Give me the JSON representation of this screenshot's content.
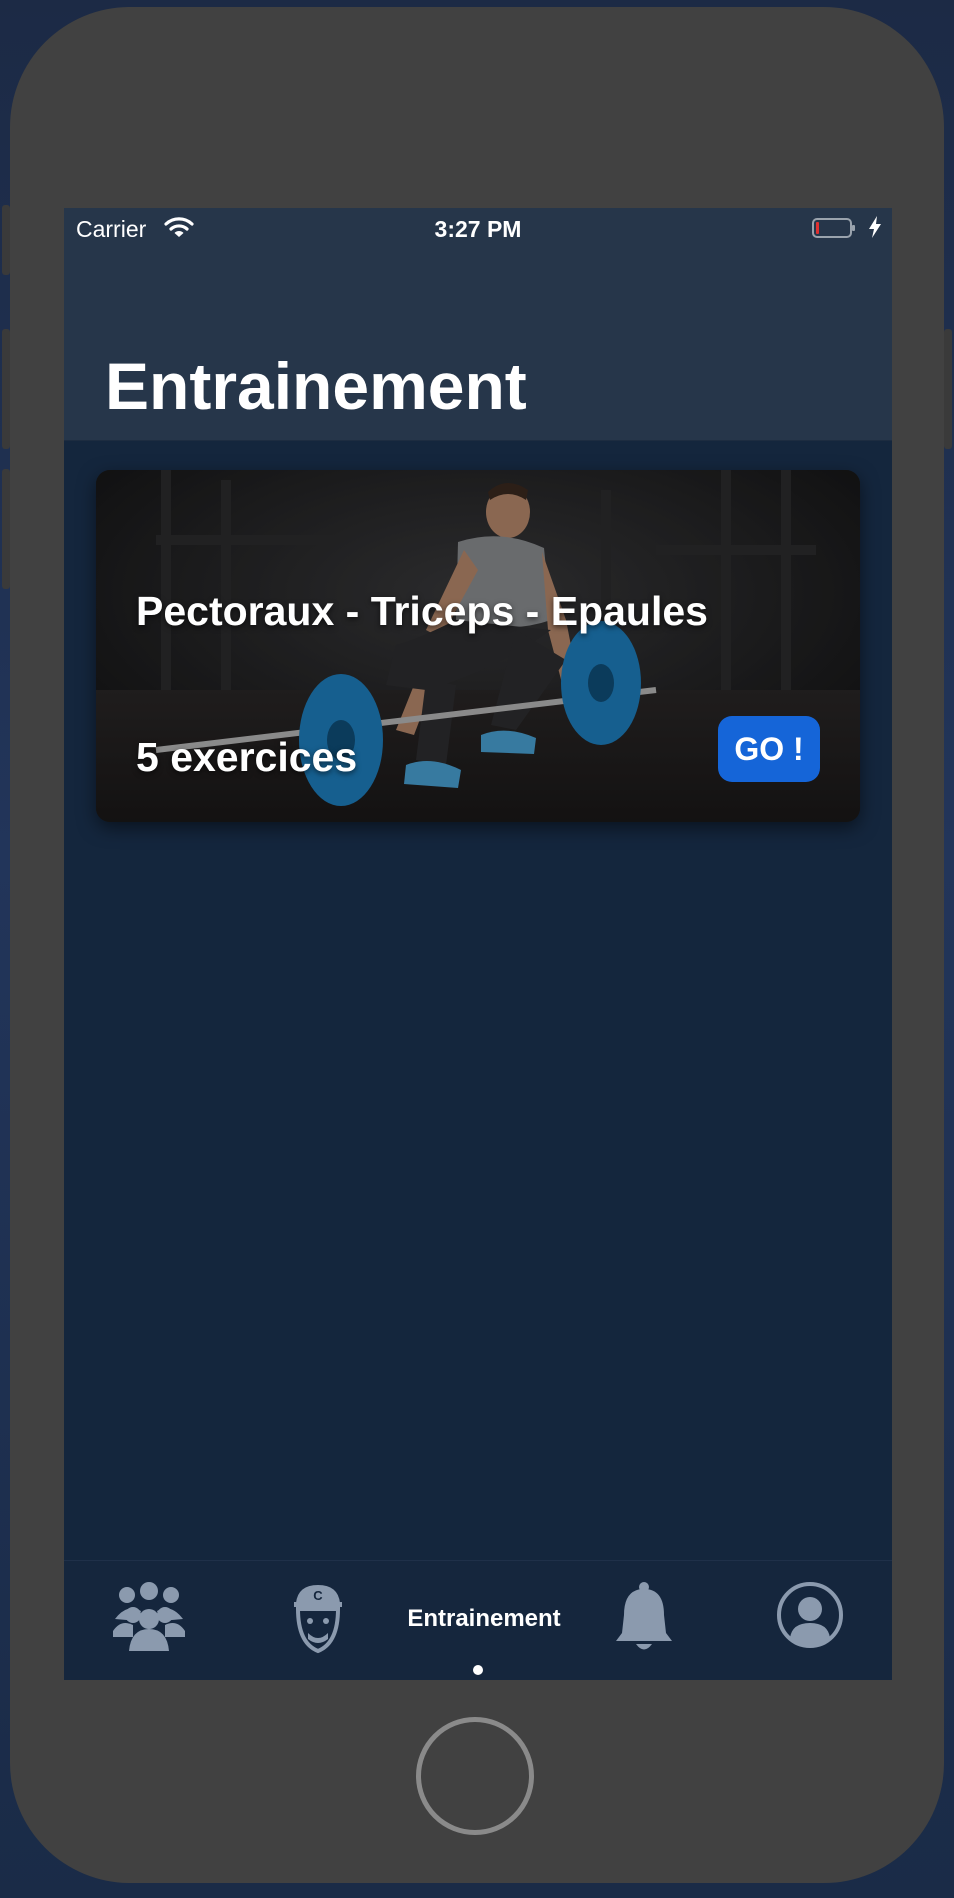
{
  "status_bar": {
    "carrier": "Carrier",
    "time": "3:27 PM",
    "battery_color": "#e03030"
  },
  "header": {
    "title": "Entrainement"
  },
  "workout_card": {
    "title": "Pectoraux - Triceps - Epaules",
    "exercise_count": "5 exercices",
    "go_label": "GO !",
    "go_color": "#1565d8"
  },
  "tabbar": {
    "items": [
      {
        "icon": "group-icon"
      },
      {
        "icon": "coach-icon"
      },
      {
        "label": "Entrainement",
        "active": true
      },
      {
        "icon": "bell-icon"
      },
      {
        "icon": "profile-icon"
      }
    ]
  },
  "colors": {
    "header_bg": "#26364a",
    "screen_bg": "#14263d",
    "tab_icon": "#8b9aae",
    "accent": "#1565d8"
  }
}
